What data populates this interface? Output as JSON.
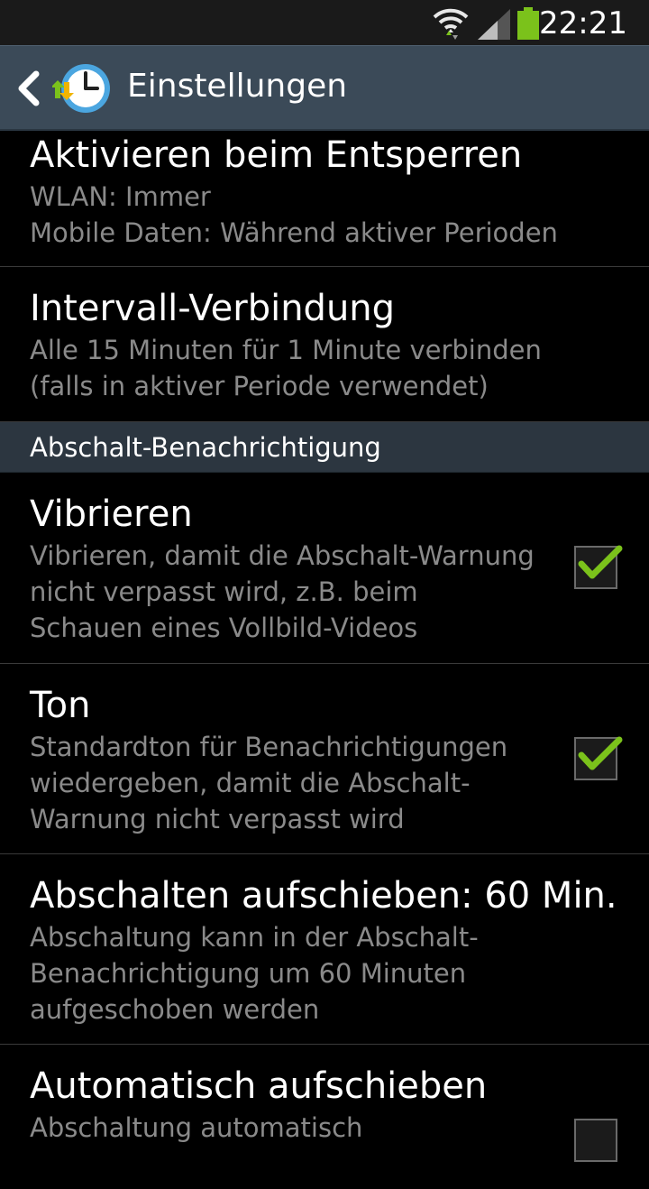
{
  "status_bar": {
    "time": "22:21",
    "battery_color": "#7bc21b"
  },
  "action_bar": {
    "back_icon": "chevron-left-icon",
    "app_icon": "clock-arrows-icon",
    "title": "Einstellungen"
  },
  "preferences": [
    {
      "title": "Aktivieren beim Entsperren",
      "summary": [
        "WLAN: Immer",
        "Mobile Daten: Während aktiver Perioden"
      ]
    },
    {
      "title": "Intervall-Verbindung",
      "summary": [
        "Alle 15 Minuten für 1 Minute verbinden",
        "(falls in aktiver Periode verwendet)"
      ]
    }
  ],
  "section": {
    "header": "Abschalt-Benachrichtigung",
    "items": [
      {
        "title": "Vibrieren",
        "summary": [
          "Vibrieren, damit die Abschalt-Warnung",
          "nicht verpasst wird, z.B. beim",
          "Schauen eines Vollbild-Videos"
        ],
        "checked": true
      },
      {
        "title": "Ton",
        "summary": [
          "Standardton für Benachrichtigungen",
          "wiedergeben, damit die Abschalt-",
          "Warnung nicht verpasst wird"
        ],
        "checked": true
      },
      {
        "title": "Abschalten aufschieben: 60 Min.",
        "summary": [
          "Abschaltung kann in der Abschalt-",
          "Benachrichtigung um 60 Minuten",
          "aufgeschoben werden"
        ]
      },
      {
        "title": "Automatisch aufschieben",
        "summary": [
          "Abschaltung automatisch"
        ],
        "checked": false
      }
    ]
  },
  "accent_color": "#7bc21b"
}
